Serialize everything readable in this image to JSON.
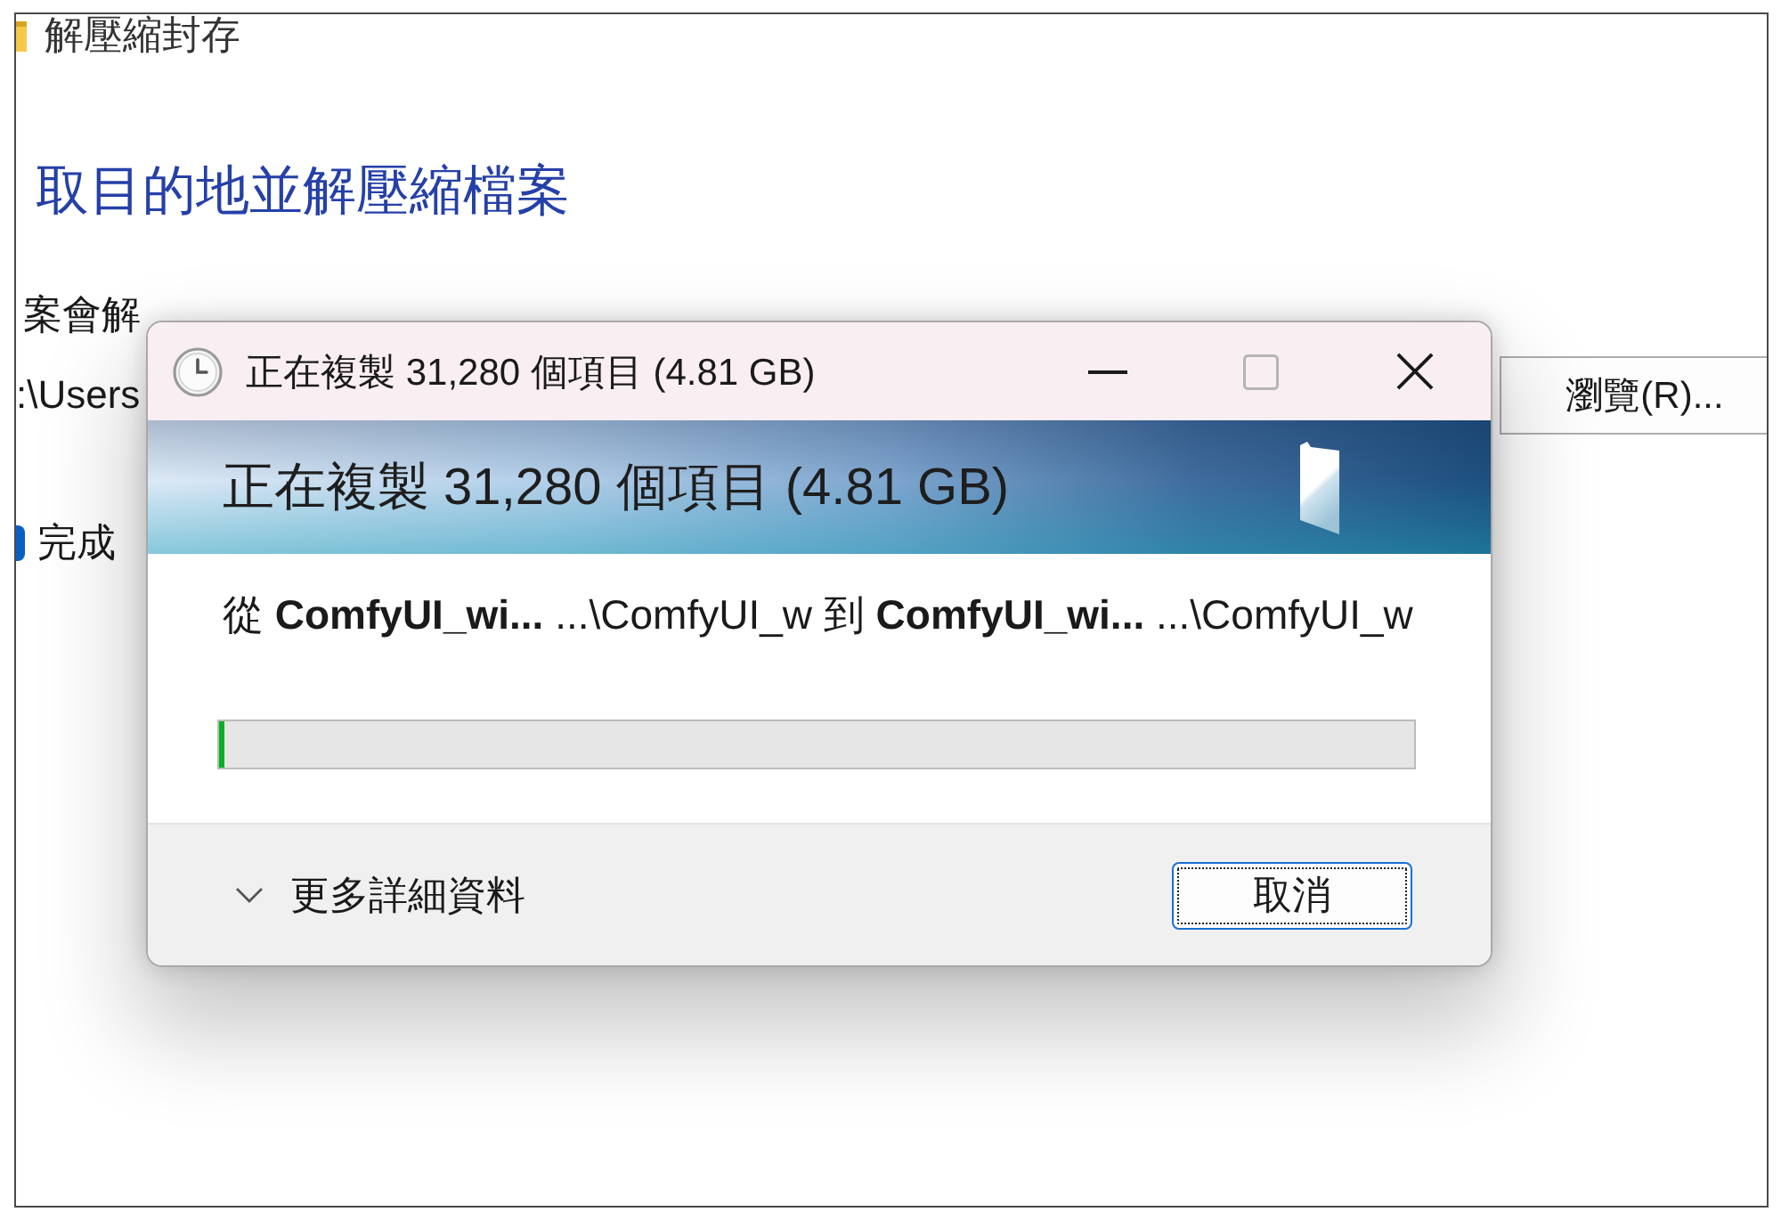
{
  "background_window": {
    "title": "解壓縮封存",
    "heading": "取目的地並解壓縮檔案",
    "folder_label": "案會解",
    "path_field": {
      "value": ":\\Users"
    },
    "browse_button": "瀏覽(R)...",
    "show_files_checkbox": {
      "label": "完成",
      "checked": true
    }
  },
  "dialog": {
    "title": "正在複製 31,280 個項目 (4.81 GB)",
    "window_controls": [
      {
        "kind": "minimize",
        "disabled": false
      },
      {
        "kind": "maximize",
        "disabled": true
      },
      {
        "kind": "close",
        "disabled": false
      }
    ],
    "banner_title": "正在複製 31,280 個項目 (4.81 GB)",
    "transfer_line": "從 **ComfyUI_wi...** ...\\ComfyUI_w 到 **ComfyUI_wi...** ...\\ComfyUI_w",
    "progress": {
      "level": 0.004
    },
    "details_toggle": {
      "label": "更多詳細資料",
      "expanded": false
    },
    "cancel_button": {
      "label": "取消",
      "focused": true
    }
  }
}
